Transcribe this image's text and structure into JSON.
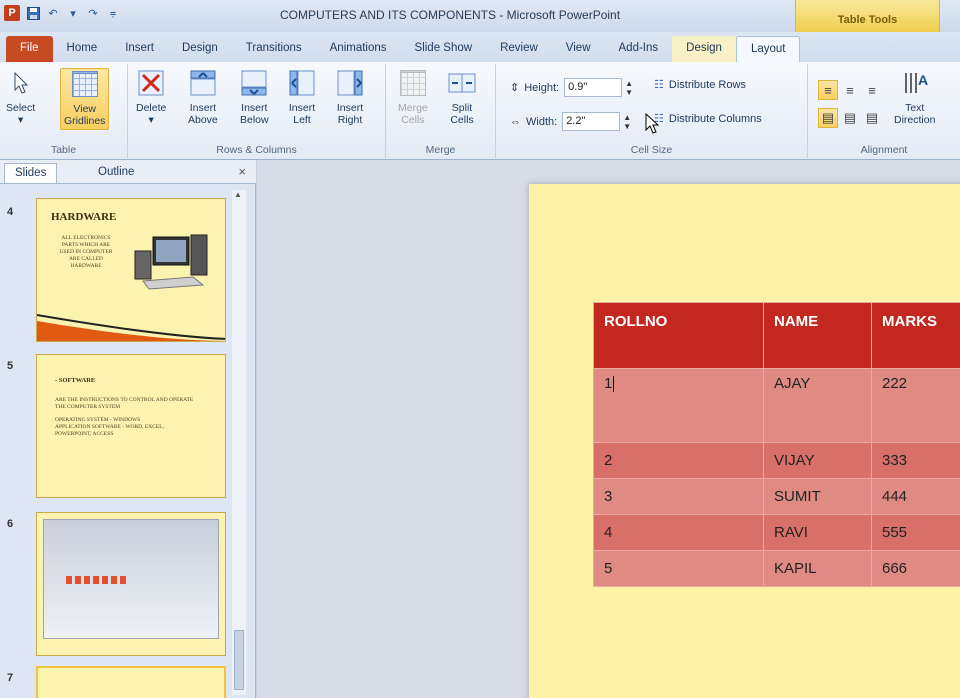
{
  "window": {
    "title": "COMPUTERS AND ITS COMPONENTS - Microsoft PowerPoint",
    "app_icon": "P",
    "context_tab_group": "Table Tools"
  },
  "tabs": [
    "File",
    "Home",
    "Insert",
    "Design",
    "Transitions",
    "Animations",
    "Slide Show",
    "Review",
    "View",
    "Add-Ins",
    "Design",
    "Layout"
  ],
  "ribbon": {
    "table": {
      "label": "Table",
      "select": "Select",
      "view": "View",
      "gridlines": "Gridlines"
    },
    "rows_columns": {
      "label": "Rows & Columns",
      "delete": "Delete",
      "insert_above": [
        "Insert",
        "Above"
      ],
      "insert_below": [
        "Insert",
        "Below"
      ],
      "insert_left": [
        "Insert",
        "Left"
      ],
      "insert_right": [
        "Insert",
        "Right"
      ]
    },
    "merge": {
      "label": "Merge",
      "merge_cells": [
        "Merge",
        "Cells"
      ],
      "split_cells": [
        "Split",
        "Cells"
      ]
    },
    "cell_size": {
      "label": "Cell Size",
      "height_label": "Height:",
      "height_value": "0.9\"",
      "width_label": "Width:",
      "width_value": "2.2\"",
      "distribute_rows": "Distribute Rows",
      "distribute_columns": "Distribute Columns"
    },
    "alignment": {
      "label": "Alignment",
      "text_direction": [
        "Text",
        "Direction"
      ]
    }
  },
  "slides_pane": {
    "tabs": [
      "Slides",
      "Outline"
    ],
    "close": "×",
    "slides": [
      {
        "num": "4",
        "title": "HARDWARE",
        "lines": [
          "ALL ELECTRONICS",
          "PARTS WHICH ARE",
          "USED IN COMPUTER",
          "ARE CALLED",
          "HARDWARE"
        ]
      },
      {
        "num": "5",
        "title": "- SOFTWARE",
        "lines": [
          "ARE THE INSTRUCTIONS TO CONTROL AND OPERATE",
          "THE COMPUTER SYSTEM",
          "OPERATING SYSTEM  -  WINDOWS",
          "APPLICATION SOFTWARE  - WORD, EXCEL,",
          "POWERPOINT, ACCESS"
        ]
      },
      {
        "num": "6",
        "title": "",
        "lines": []
      },
      {
        "num": "7",
        "title": "",
        "lines": []
      }
    ]
  },
  "slide_table": {
    "headers": [
      "ROLLNO",
      "NAME",
      "MARKS"
    ],
    "rows": [
      [
        "1",
        "AJAY",
        "222"
      ],
      [
        "2",
        "VIJAY",
        "333"
      ],
      [
        "3",
        "SUMIT",
        "444"
      ],
      [
        "4",
        "RAVI",
        "555"
      ],
      [
        "5",
        "KAPIL",
        "666"
      ]
    ]
  },
  "colors": {
    "file_tab": "#c74a23",
    "table_header": "#c2281f",
    "slide_bg": "#fdf2a6"
  }
}
